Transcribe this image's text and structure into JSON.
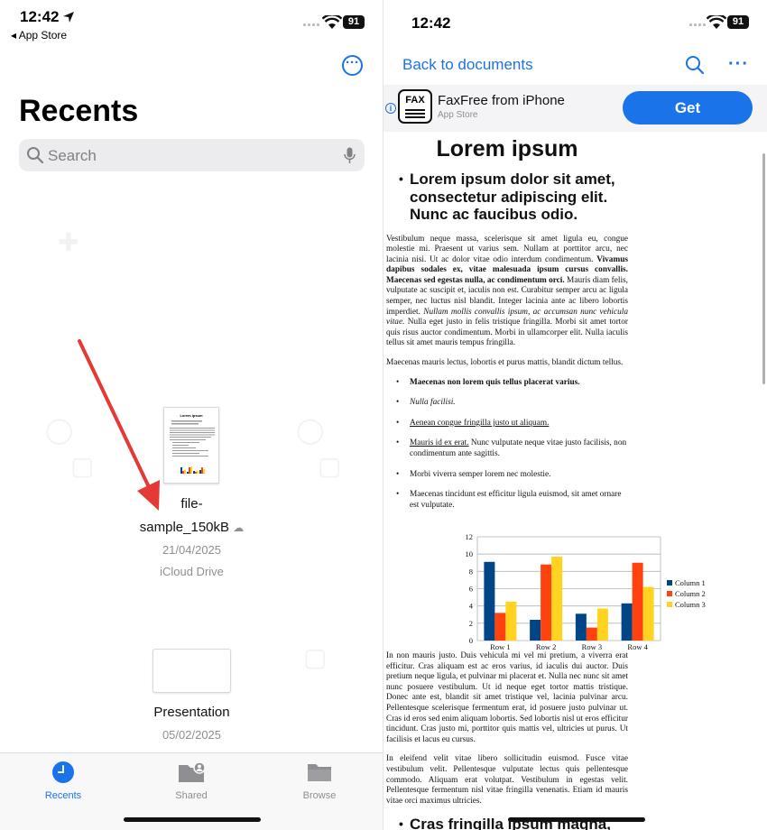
{
  "left": {
    "status": {
      "time": "12:42",
      "back_app": "◂ App Store",
      "battery": "91"
    },
    "title": "Recents",
    "search": {
      "placeholder": "Search"
    },
    "files": [
      {
        "name_line1": "file-",
        "name_line2": "sample_150kB",
        "date": "21/04/2025",
        "location": "iCloud Drive"
      },
      {
        "name": "Presentation",
        "date": "05/02/2025"
      }
    ],
    "thumb_title": "Lorem ipsum",
    "tabs": [
      {
        "label": "Recents",
        "icon": "clock-icon",
        "active": true
      },
      {
        "label": "Shared",
        "icon": "shared-folder-icon",
        "active": false
      },
      {
        "label": "Browse",
        "icon": "folder-icon",
        "active": false
      }
    ],
    "annotation_color": "#e53935"
  },
  "right": {
    "status": {
      "time": "12:42",
      "battery": "91"
    },
    "nav": {
      "back_label": "Back to documents"
    },
    "ad": {
      "app_name": "FaxFree from iPhone",
      "store": "App Store",
      "icon_text": "FAX",
      "cta": "Get"
    },
    "doc": {
      "title": "Lorem ipsum",
      "heading": "Lorem ipsum dolor sit amet, consectetur adipiscing elit. Nunc ac faucibus odio.",
      "p1_a": "Vestibulum neque massa, scelerisque sit amet ligula eu, congue molestie mi. Praesent ut varius sem. Nullam at porttitor arcu, nec lacinia nisi. Ut ac dolor vitae odio interdum condimentum. ",
      "p1_b": "Vivamus dapibus sodales ex, vitae malesuada ipsum cursus convallis. Maecenas sed egestas nulla, ac condimentum orci.",
      "p1_c": " Mauris diam felis, vulputate ac suscipit et, iaculis non est. Curabitur semper arcu ac ligula semper, nec luctus nisl blandit. Integer lacinia ante ac libero lobortis imperdiet. ",
      "p1_d": "Nullam mollis convallis ipsum, ac accumsan nunc vehicula vitae.",
      "p1_e": " Nulla eget justo in felis tristique fringilla. Morbi sit amet tortor quis risus auctor condimentum. Morbi in ullamcorper elit. Nulla iaculis tellus sit amet mauris tempus fringilla.",
      "p2": "Maecenas mauris lectus, lobortis et purus mattis, blandit dictum tellus.",
      "li1": "Maecenas non lorem quis tellus placerat varius.",
      "li2": "Nulla facilisi.",
      "li3": "Aenean congue fringilla justo ut aliquam.",
      "li4_a": "Mauris id ex erat.",
      "li4_b": " Nunc vulputate neque vitae justo facilisis, non condimentum ante sagittis.",
      "li5": "Morbi viverra semper lorem nec molestie.",
      "li6": "Maecenas tincidunt est efficitur ligula euismod, sit amet ornare est vulputate.",
      "p3": "In non mauris justo. Duis vehicula mi vel mi pretium, a viverra erat efficitur. Cras aliquam est ac eros varius, id iaculis dui auctor. Duis pretium neque ligula, et pulvinar mi placerat et. Nulla nec nunc sit amet nunc posuere vestibulum. Ut id neque eget tortor mattis tristique. Donec ante est, blandit sit amet tristique vel, lacinia pulvinar arcu. Pellentesque scelerisque fermentum erat, id posuere justo pulvinar ut. Cras id eros sed enim aliquam lobortis. Sed lobortis nisl ut eros efficitur tincidunt. Cras justo mi, porttitor quis mattis vel, ultricies ut purus. Ut facilisis et lacus eu cursus.",
      "p4": "In eleifend velit vitae libero sollicitudin euismod. Fusce vitae vestibulum velit. Pellentesque vulputate lectus quis pellentesque commodo. Aliquam erat volutpat. Vestibulum in egestas velit. Pellentesque fermentum nisl vitae fringilla venenatis. Etiam id mauris vitae orci maximus ultricies.",
      "h_next": "Cras fringilla ipsum magna, in"
    }
  },
  "chart_data": {
    "type": "bar",
    "categories": [
      "Row 1",
      "Row 2",
      "Row 3",
      "Row 4"
    ],
    "series": [
      {
        "name": "Column 1",
        "values": [
          9.1,
          2.4,
          3.1,
          4.3
        ],
        "color": "#004586"
      },
      {
        "name": "Column 2",
        "values": [
          3.2,
          8.8,
          1.5,
          9.0
        ],
        "color": "#ff420e"
      },
      {
        "name": "Column 3",
        "values": [
          4.5,
          9.7,
          3.7,
          6.2
        ],
        "color": "#ffd320"
      }
    ],
    "ylim": [
      0,
      12
    ],
    "yticks": [
      0,
      2,
      4,
      6,
      8,
      10,
      12
    ],
    "legend": "right",
    "grid": true
  }
}
